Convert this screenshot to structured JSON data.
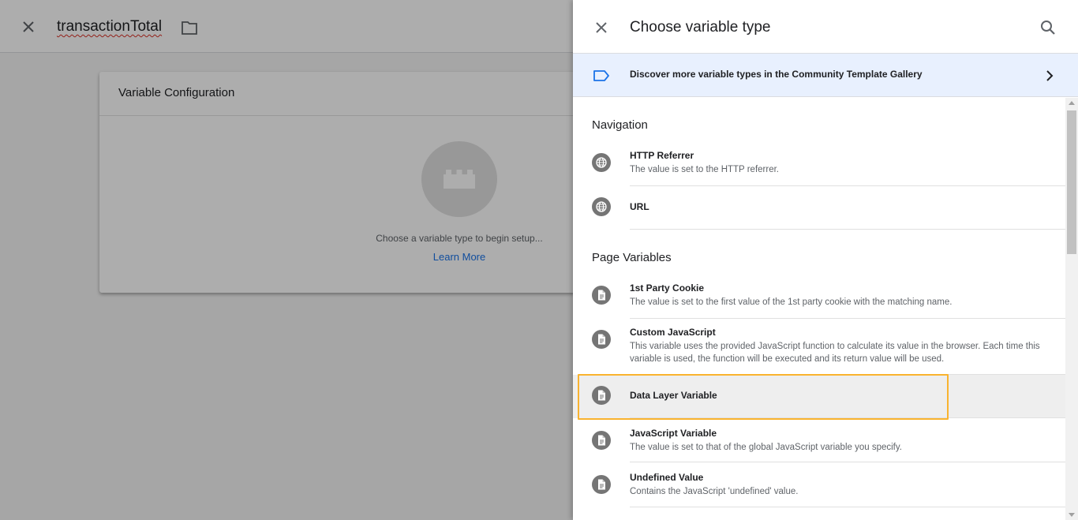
{
  "editor": {
    "variable_name": "transactionTotal",
    "card": {
      "title": "Variable Configuration",
      "hint": "Choose a variable type to begin setup...",
      "learn_more": "Learn More"
    }
  },
  "panel": {
    "title": "Choose variable type",
    "banner": "Discover more variable types in the Community Template Gallery",
    "sections": {
      "navigation": {
        "title": "Navigation",
        "items": [
          {
            "name": "HTTP Referrer",
            "description": "The value is set to the HTTP referrer.",
            "icon": "globe-icon"
          },
          {
            "name": "URL",
            "description": "",
            "icon": "globe-icon"
          }
        ]
      },
      "page_variables": {
        "title": "Page Variables",
        "items": [
          {
            "name": "1st Party Cookie",
            "description": "The value is set to the first value of the 1st party cookie with the matching name.",
            "icon": "document-icon"
          },
          {
            "name": "Custom JavaScript",
            "description": "This variable uses the provided JavaScript function to calculate its value in the browser. Each time this variable is used, the function will be executed and its return value will be used.",
            "icon": "document-icon"
          },
          {
            "name": "Data Layer Variable",
            "description": "",
            "icon": "document-icon"
          },
          {
            "name": "JavaScript Variable",
            "description": "The value is set to that of the global JavaScript variable you specify.",
            "icon": "document-icon"
          },
          {
            "name": "Undefined Value",
            "description": "Contains the JavaScript 'undefined' value.",
            "icon": "document-icon"
          }
        ]
      }
    }
  },
  "colors": {
    "accent": "#1a73e8",
    "highlight_border": "#f9b32f",
    "banner_bg": "#e8f0fe",
    "icon_bg": "#757575"
  }
}
